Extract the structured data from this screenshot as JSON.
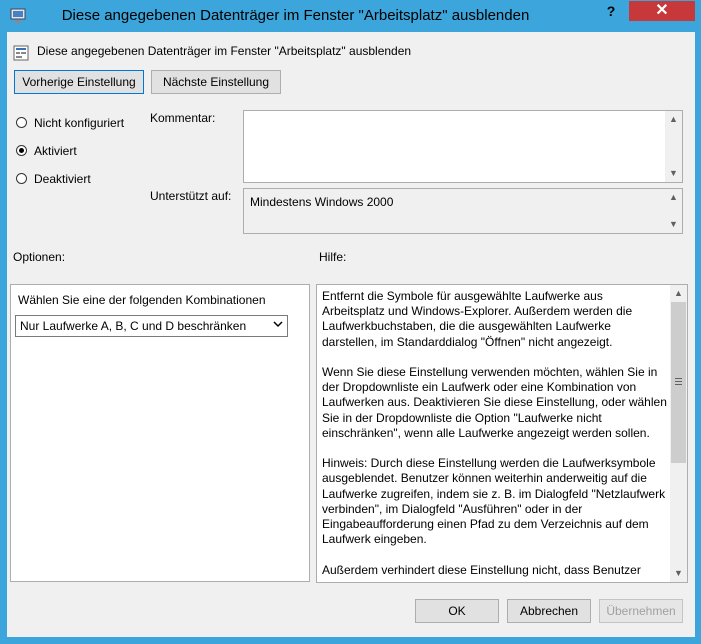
{
  "window": {
    "title": "Diese angegebenen Datenträger im Fenster \"Arbeitsplatz\" ausblenden",
    "help_label": "?",
    "close_label": "✕",
    "colors": {
      "frame": "#3ca6dc",
      "close": "#c7383a",
      "client": "#f0f0f0"
    }
  },
  "policy": {
    "title": "Diese angegebenen Datenträger im Fenster \"Arbeitsplatz\" ausblenden"
  },
  "nav": {
    "prev_label": "Vorherige Einstellung",
    "next_label": "Nächste Einstellung"
  },
  "state": {
    "options": [
      {
        "label": "Nicht konfiguriert",
        "selected": false
      },
      {
        "label": "Aktiviert",
        "selected": true
      },
      {
        "label": "Deaktiviert",
        "selected": false
      }
    ]
  },
  "comment": {
    "label": "Kommentar:",
    "value": ""
  },
  "supported": {
    "label": "Unterstützt auf:",
    "value": "Mindestens Windows 2000"
  },
  "options_section": {
    "label": "Optionen:",
    "prompt": "Wählen Sie eine der folgenden Kombinationen",
    "selected": "Nur Laufwerke A, B, C und D beschränken"
  },
  "help_section": {
    "label": "Hilfe:",
    "text": "Entfernt die Symbole für ausgewählte Laufwerke aus Arbeitsplatz und Windows-Explorer. Außerdem werden die Laufwerkbuchstaben, die die ausgewählten Laufwerke darstellen, im Standarddialog \"Öffnen\" nicht angezeigt.\n\nWenn Sie diese Einstellung verwenden möchten, wählen Sie in der Dropdownliste ein Laufwerk oder eine Kombination von Laufwerken aus. Deaktivieren Sie diese Einstellung, oder wählen Sie in der Dropdownliste die Option \"Laufwerke nicht einschränken\", wenn alle Laufwerke angezeigt werden sollen.\n\nHinweis: Durch diese Einstellung werden die Laufwerksymbole ausgeblendet. Benutzer können weiterhin anderweitig auf die Laufwerke zugreifen, indem sie z. B. im Dialogfeld \"Netzlaufwerk verbinden\", im Dialogfeld \"Ausführen\" oder in der Eingabeaufforderung einen Pfad zu dem Verzeichnis auf dem Laufwerk eingeben.\n\nAußerdem verhindert diese Einstellung nicht, dass Benutzer"
  },
  "footer": {
    "ok_label": "OK",
    "cancel_label": "Abbrechen",
    "apply_label": "Übernehmen"
  }
}
